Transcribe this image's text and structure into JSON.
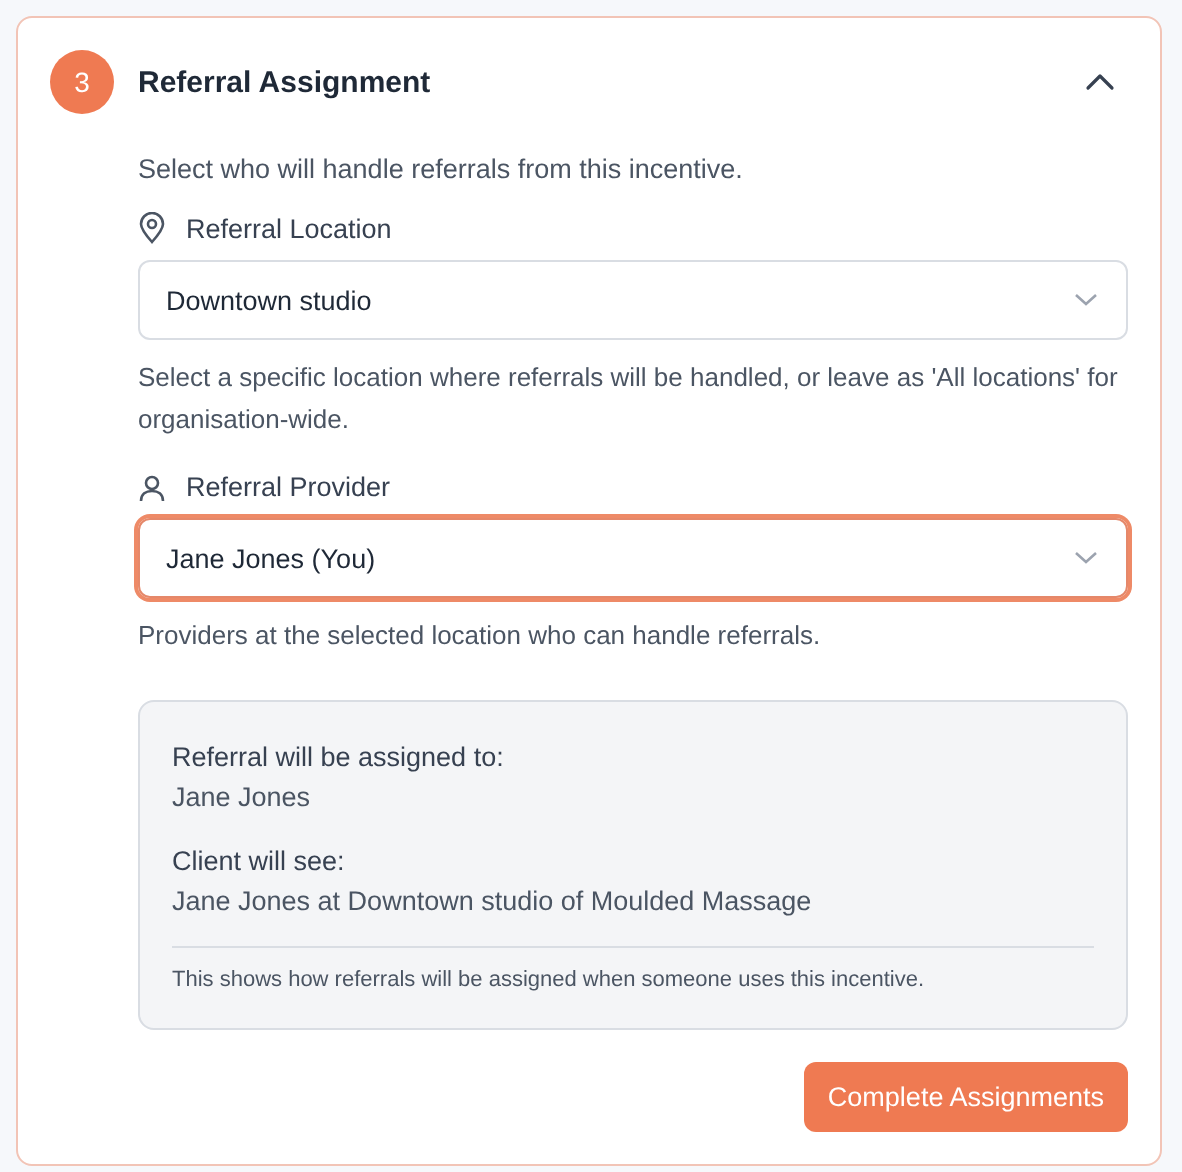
{
  "section": {
    "step": "3",
    "title": "Referral Assignment",
    "expanded": true,
    "description": "Select who will handle referrals from this incentive.",
    "fields": [
      {
        "kind": "location",
        "label": "Referral Location",
        "value": "Downtown studio",
        "focused": false,
        "hint": "Select a specific location where referrals will be handled, or leave as 'All locations' for organisation-wide."
      },
      {
        "kind": "person",
        "label": "Referral Provider",
        "value": "Jane Jones (You)",
        "focused": true,
        "hint": "Providers at the selected location who can handle referrals."
      }
    ],
    "summary": {
      "assigned_label": "Referral will be assigned to:",
      "assigned_value": "Jane Jones",
      "client_label": "Client will see:",
      "client_value": "Jane Jones at Downtown studio of Moulded Massage",
      "note": "This shows how referrals will be assigned when someone uses this incentive."
    },
    "button": "Complete Assignments"
  }
}
